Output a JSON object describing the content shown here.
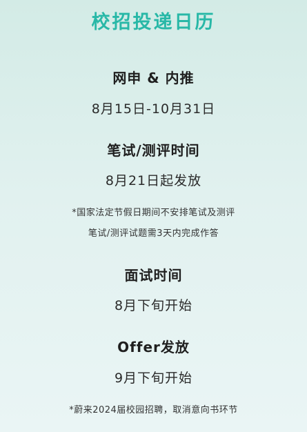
{
  "title": "校招投递日历",
  "sections": [
    {
      "heading": "网申 & 内推",
      "value": "8月15日-10月31日"
    },
    {
      "heading": "笔试/测评时间",
      "value": "8月21日起发放"
    },
    {
      "heading": "面试时间",
      "value": "8月下旬开始"
    },
    {
      "heading": "Offer发放",
      "value": "9月下旬开始"
    }
  ],
  "notes": {
    "holiday": "*国家法定节假日期间不安排笔试及测评",
    "deadline": "笔试/测评试题需3天内完成作答",
    "footer": "*蔚来2024届校园招聘，取消意向书环节"
  },
  "colors": {
    "accent": "#28b8a7",
    "background_top": "#d3ebe6",
    "background_bottom": "#eaf5f5"
  }
}
